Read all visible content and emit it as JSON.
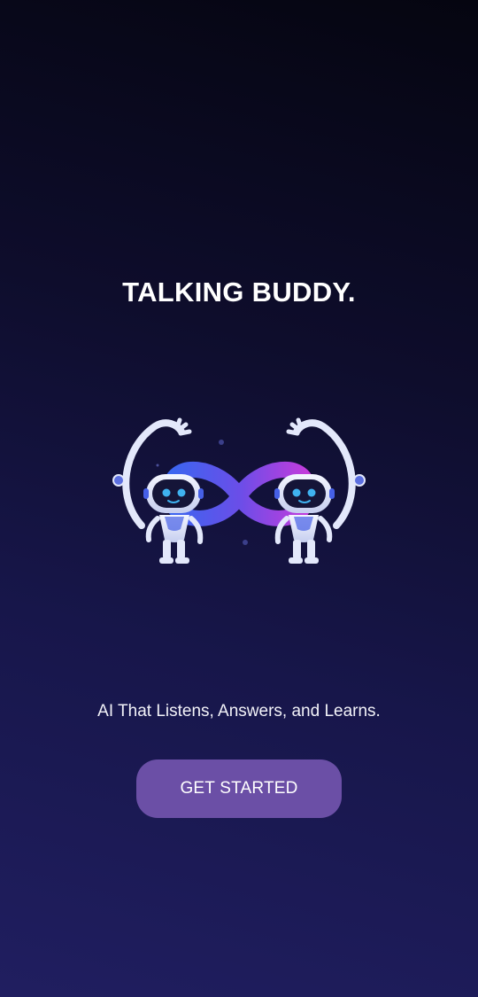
{
  "app": {
    "title": "TALKING BUDDY.",
    "tagline": "AI That Listens, Answers, and Learns."
  },
  "hero": {
    "icon": "robots-infinity-icon",
    "colors": {
      "infinity_start": "#3a66f0",
      "infinity_end": "#c43cdc",
      "robot_body": "#e8ecfb",
      "robot_face": "#151538",
      "robot_eye": "#3fb2f0",
      "robot_accent": "#4660e6"
    }
  },
  "cta": {
    "label": "GET STARTED"
  },
  "colors": {
    "background_top": "#050510",
    "background_bottom": "#201e60",
    "button": "#6b4fa6",
    "text": "#ffffff"
  }
}
